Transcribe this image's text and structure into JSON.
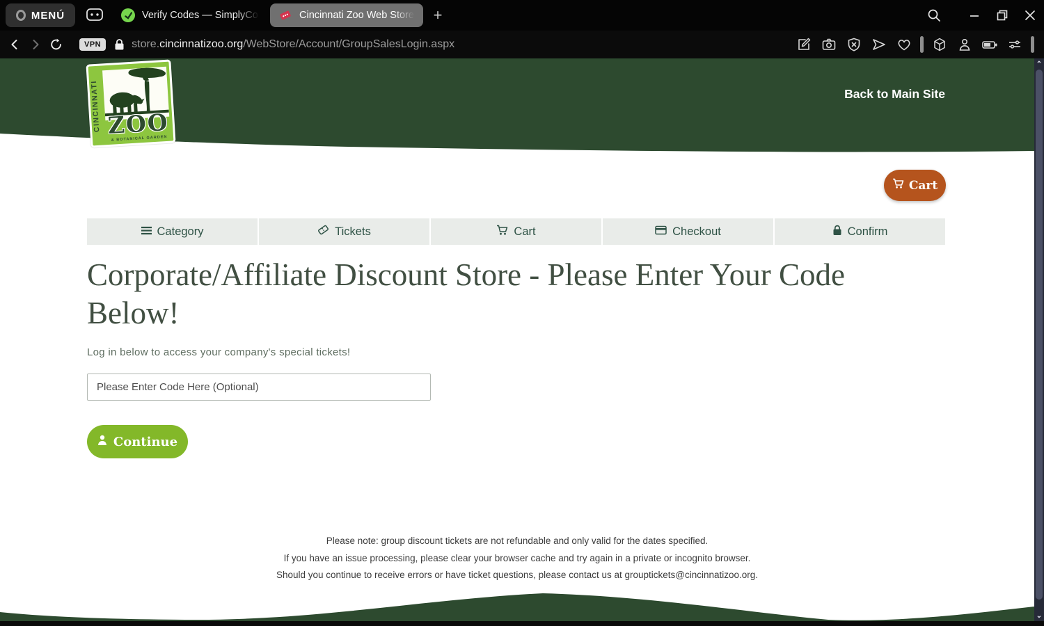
{
  "browser": {
    "menu_label": "MENÚ",
    "tabs": [
      {
        "label": "Verify Codes — SimplyCo",
        "active": false
      },
      {
        "label": "Cincinnati Zoo Web Store",
        "active": true
      }
    ],
    "new_tab_label": "+",
    "address": {
      "vpn_label": "VPN",
      "host_prefix": "store.",
      "domain": "cincinnatizoo.org",
      "path": "/WebStore/Account/GroupSalesLogin.aspx"
    }
  },
  "page": {
    "back_link": "Back to Main Site",
    "cart_button": "Cart",
    "nav": [
      {
        "label": "Category"
      },
      {
        "label": "Tickets"
      },
      {
        "label": "Cart"
      },
      {
        "label": "Checkout"
      },
      {
        "label": "Confirm"
      }
    ],
    "heading": "Corporate/Affiliate Discount Store - Please Enter Your Code Below!",
    "subheading": "Log in below to access your company's special tickets!",
    "code_input_placeholder": "Please Enter Code Here (Optional)",
    "continue_button": "Continue",
    "notes": [
      "Please note: group discount tickets are not refundable and only valid for the dates specified.",
      "If you have an issue processing, please clear your browser cache and try again in a private or incognito browser.",
      "Should you continue to receive errors or have ticket questions, please contact us at grouptickets@cincinnatizoo.org."
    ],
    "logo": {
      "top": "CINCINNATI",
      "main": "ZOO",
      "sub": "& BOTANICAL GARDEN"
    },
    "colors": {
      "header_green": "#2d4a2f",
      "accent_green": "#83b829",
      "cart_orange": "#b5541d"
    }
  }
}
